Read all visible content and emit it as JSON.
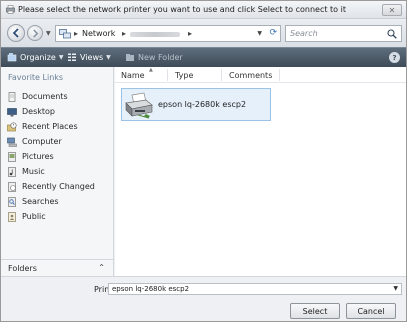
{
  "window": {
    "title": "Please select the network printer you want to use and click Select to connect to it",
    "close_glyph": "✕"
  },
  "address": {
    "crumb_network": "Network",
    "separator": "▸",
    "search_placeholder": "Search"
  },
  "toolbar": {
    "organize_label": "Organize",
    "views_label": "Views",
    "new_folder_label": "New Folder",
    "help_glyph": "?"
  },
  "sidebar": {
    "header": "Favorite Links",
    "items": [
      {
        "label": "Documents",
        "icon": "documents-icon"
      },
      {
        "label": "Desktop",
        "icon": "desktop-icon"
      },
      {
        "label": "Recent Places",
        "icon": "recent-places-icon"
      },
      {
        "label": "Computer",
        "icon": "computer-icon"
      },
      {
        "label": "Pictures",
        "icon": "pictures-icon"
      },
      {
        "label": "Music",
        "icon": "music-icon"
      },
      {
        "label": "Recently Changed",
        "icon": "recently-changed-icon"
      },
      {
        "label": "Searches",
        "icon": "searches-icon"
      },
      {
        "label": "Public",
        "icon": "public-icon"
      }
    ],
    "folders_label": "Folders",
    "folders_toggle": "⌃"
  },
  "file_list": {
    "columns": [
      "Name",
      "Type",
      "Comments"
    ],
    "items": [
      {
        "label": "epson lq-2680k escp2",
        "icon": "printer-icon",
        "selected": true
      }
    ]
  },
  "bottom": {
    "printer_label": "Printer",
    "printer_value": "epson lq-2680k escp2",
    "select_label": "Select",
    "cancel_label": "Cancel"
  },
  "colors": {
    "toolbar": "#4a5866",
    "selection_fill": "#e6f0fa",
    "selection_border": "#9cc3e6",
    "sidebar_header": "#6b7f96"
  }
}
